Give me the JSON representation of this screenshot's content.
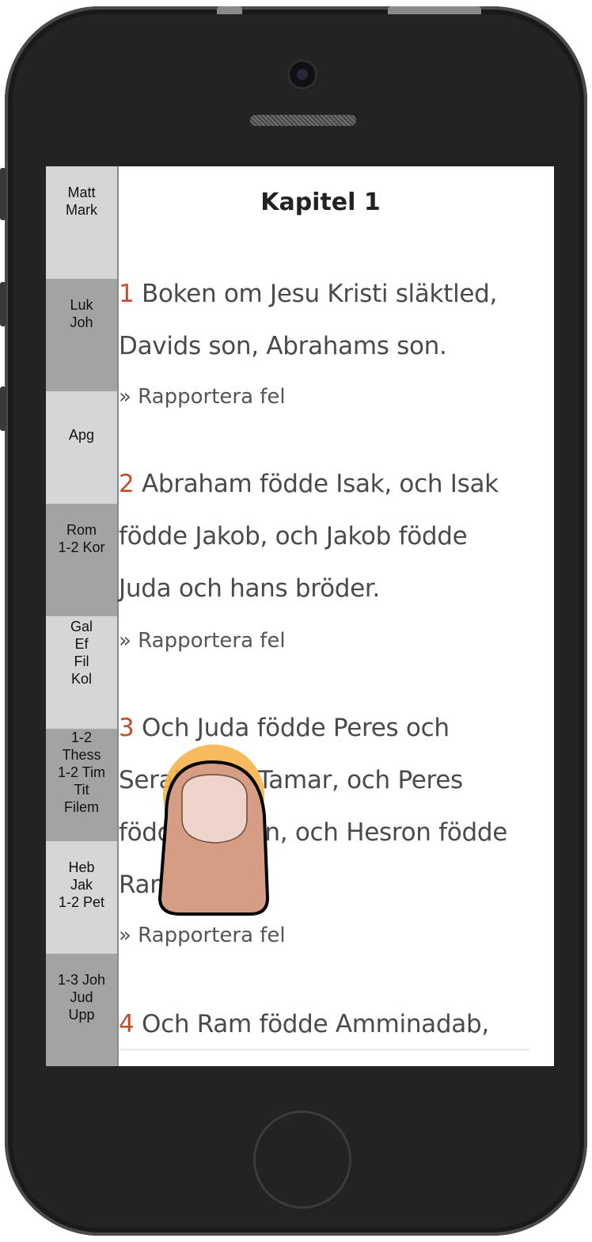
{
  "sidebar": {
    "items": [
      {
        "label": "Matt\nMark",
        "shade": "light"
      },
      {
        "label": "Luk\nJoh",
        "shade": "dark"
      },
      {
        "label": "Apg",
        "shade": "light"
      },
      {
        "label": "Rom\n1-2 Kor",
        "shade": "dark"
      },
      {
        "label": "Gal\nEf\nFil\nKol",
        "shade": "light"
      },
      {
        "label": "1-2\nThess\n1-2 Tim\nTit\nFilem",
        "shade": "dark"
      },
      {
        "label": "Heb\nJak\n1-2 Pet",
        "shade": "light"
      },
      {
        "label": "1-3 Joh\nJud\nUpp",
        "shade": "dark"
      }
    ]
  },
  "chapter": {
    "title": "Kapitel 1",
    "report_label": "» Rapportera fel",
    "verses": [
      {
        "number": "1",
        "lines": [
          "Boken om Jesu Kristi släktled,",
          "Davids son, Abrahams son."
        ]
      },
      {
        "number": "2",
        "lines": [
          "Abraham födde Isak, och Isak",
          "födde Jakob, och Jakob födde",
          "Juda och hans bröder."
        ]
      },
      {
        "number": "3",
        "lines": [
          "Och Juda födde Peres och",
          "Serah med Tamar, och Peres",
          "födde Hesron, och Hesron födde",
          "Ram."
        ]
      },
      {
        "number": "4",
        "lines": [
          "Och Ram födde Amminadab,"
        ]
      }
    ]
  },
  "colors": {
    "verse_number": "#c0502e",
    "sidebar_light": "#d6d6d6",
    "sidebar_dark": "#a3a3a3",
    "phone_body": "#232323"
  },
  "icons": {
    "tap_indicator": "finger-tap-icon"
  }
}
